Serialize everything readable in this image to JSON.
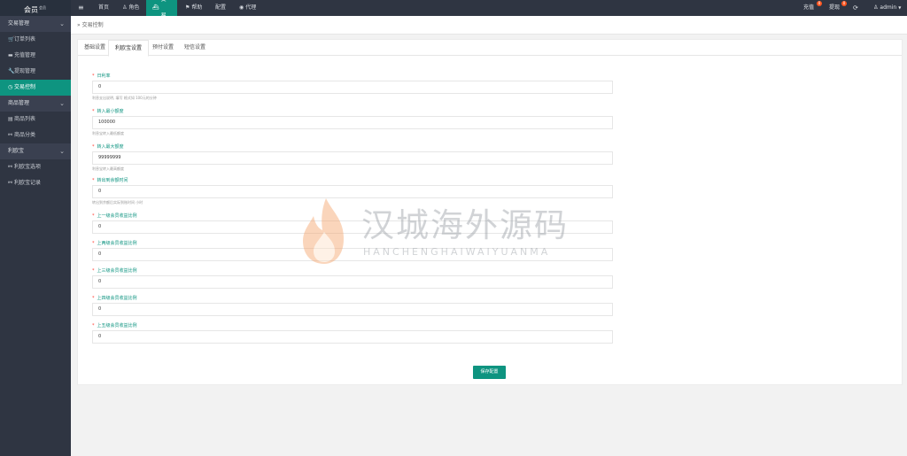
{
  "sidebar": {
    "logo": "会员",
    "logo_sup": "会员",
    "groups": [
      {
        "label": "交易管理"
      },
      {
        "label": "商品管理"
      },
      {
        "label": "利欧宝"
      }
    ],
    "items": [
      {
        "label": "订单列表",
        "icon": "cart-icon"
      },
      {
        "label": "充值管理",
        "icon": "card-icon"
      },
      {
        "label": "提现管理",
        "icon": "wrench-icon"
      },
      {
        "label": "交易控制",
        "icon": "clock-icon"
      },
      {
        "label": "商品列表",
        "icon": "shop-icon"
      },
      {
        "label": "商品分类",
        "icon": "link-icon"
      },
      {
        "label": "利欧宝选项",
        "icon": "link-icon"
      },
      {
        "label": "利欧宝记录",
        "icon": "link-icon"
      }
    ]
  },
  "topbar": {
    "nav": [
      {
        "label": "首页"
      },
      {
        "label": "角色"
      },
      {
        "label": "交易"
      },
      {
        "label": "帮助"
      },
      {
        "label": "配置"
      },
      {
        "label": "代理"
      }
    ],
    "recharge_label": "充值",
    "recharge_badge": "0",
    "withdraw_label": "提现",
    "withdraw_badge": "0",
    "user": "admin"
  },
  "breadcrumb": "交易控制",
  "tabs": [
    "基础设置",
    "利欧宝设置",
    "预付设置",
    "短信设置"
  ],
  "form": {
    "fields": [
      {
        "label": "日利率",
        "value": "0",
        "hint": "利息支出说明, 填写 格式如 100元的分钟"
      },
      {
        "label": "转入最小额度",
        "value": "100000",
        "hint": "利息宝转入最低额度"
      },
      {
        "label": "转入最大额度",
        "value": "99999999",
        "hint": "利息宝转入最高额度"
      },
      {
        "label": "转出到余额时间",
        "value": "0",
        "hint": "转出到余额后实际到账时间 小时"
      },
      {
        "label": "上一级会员收益比例",
        "value": "0",
        "hint": ""
      },
      {
        "label": "上两级会员收益比例",
        "value": "0",
        "hint": ""
      },
      {
        "label": "上三级会员收益比例",
        "value": "0",
        "hint": ""
      },
      {
        "label": "上四级会员收益比例",
        "value": "0",
        "hint": ""
      },
      {
        "label": "上五级会员收益比例",
        "value": "0",
        "hint": ""
      }
    ],
    "save_label": "保存配置"
  },
  "watermark": {
    "cn": "汉城海外源码",
    "en": "HANCHENGHAIWAIYUANMA"
  }
}
